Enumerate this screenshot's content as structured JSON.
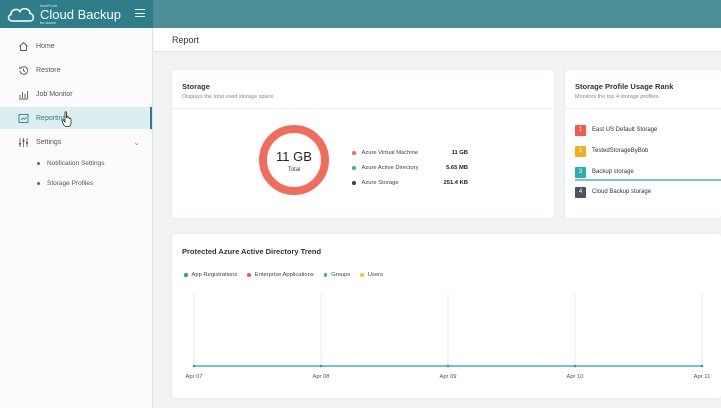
{
  "brand": {
    "name": "Cloud Backup",
    "small_text": "AvePoint",
    "sub_text": "for Azure"
  },
  "sidebar": {
    "items": [
      {
        "label": "Home",
        "icon": "home-icon"
      },
      {
        "label": "Restore",
        "icon": "restore-icon"
      },
      {
        "label": "Job Monitor",
        "icon": "job-monitor-icon"
      },
      {
        "label": "Reporting",
        "icon": "reporting-icon",
        "active": true
      },
      {
        "label": "Settings",
        "icon": "settings-icon"
      }
    ],
    "sub_items": [
      {
        "label": "Notification Settings"
      },
      {
        "label": "Storage Profiles"
      }
    ]
  },
  "page": {
    "title": "Report"
  },
  "storage": {
    "title": "Storage",
    "subtitle": "Displays the total used storage space.",
    "total_value": "11 GB",
    "total_label": "Total",
    "legend": [
      {
        "name": "Azure Virtual Machine",
        "value": "11 GB",
        "color": "#f0705f"
      },
      {
        "name": "Azure Active Directory",
        "value": "5.65 MB",
        "color": "#3bb3a9"
      },
      {
        "name": "Azure Storage",
        "value": "251.4 KB",
        "color": "#444444"
      }
    ],
    "ring_color": "#f26b5b"
  },
  "rank": {
    "title": "Storage Profile Usage Rank",
    "subtitle": "Monitors the top 4 storage profiles.",
    "items": [
      {
        "rank": "1",
        "name": "East US Default Storage",
        "color": "#ef5b4c"
      },
      {
        "rank": "2",
        "name": "TestedStorageByBob",
        "color": "#f2b01e"
      },
      {
        "rank": "3",
        "name": "Backup storage",
        "color": "#2ab0a8"
      },
      {
        "rank": "4",
        "name": "Cloud Backup storage",
        "color": "#4a5560"
      }
    ]
  },
  "trend": {
    "title": "Protected Azure Active Directory Trend",
    "legend": [
      {
        "name": "App Registrations",
        "color": "#2a9fa8"
      },
      {
        "name": "Enterprise Applications",
        "color": "#ef5b4c"
      },
      {
        "name": "Groups",
        "color": "#3cb878"
      },
      {
        "name": "Users",
        "color": "#f2c230"
      }
    ]
  },
  "chart_data": {
    "type": "line",
    "x": [
      "Apr 07",
      "Apr 08",
      "Apr 09",
      "Apr 10",
      "Apr 11"
    ],
    "series": [
      {
        "name": "App Registrations",
        "values": [
          0,
          0,
          0,
          0,
          0
        ]
      },
      {
        "name": "Enterprise Applications",
        "values": [
          0,
          0,
          0,
          0,
          0
        ]
      },
      {
        "name": "Groups",
        "values": [
          0,
          0,
          0,
          0,
          0
        ]
      },
      {
        "name": "Users",
        "values": [
          0,
          0,
          0,
          0,
          0
        ]
      }
    ],
    "title": "Protected Azure Active Directory Trend",
    "grid": true,
    "legend_position": "top-left"
  }
}
